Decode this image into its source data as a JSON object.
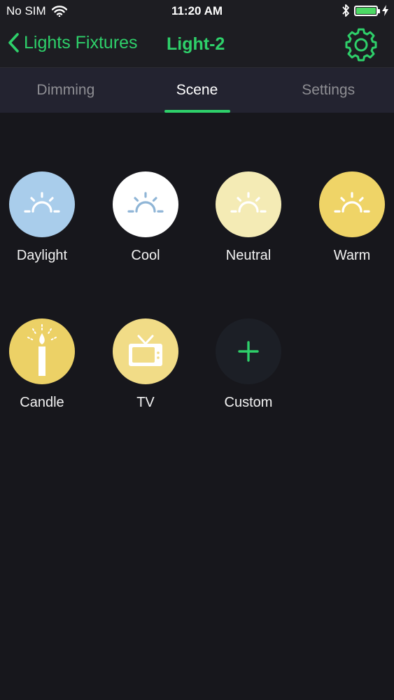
{
  "status": {
    "carrier": "No SIM",
    "time": "11:20 AM"
  },
  "nav": {
    "back_label": "Lights Fixtures",
    "title": "Light-2"
  },
  "tabs": [
    {
      "label": "Dimming"
    },
    {
      "label": "Scene"
    },
    {
      "label": "Settings"
    }
  ],
  "active_tab": "Scene",
  "scenes": [
    {
      "label": "Daylight",
      "color": "#a9cdeb",
      "icon": "sunrise-icon"
    },
    {
      "label": "Cool",
      "color": "#ffffff",
      "icon": "sunrise-icon"
    },
    {
      "label": "Neutral",
      "color": "#f4ebb5",
      "icon": "sunrise-icon"
    },
    {
      "label": "Warm",
      "color": "#efd467",
      "icon": "sunrise-icon"
    },
    {
      "label": "Candle",
      "color": "#ecd166",
      "icon": "candle-icon"
    },
    {
      "label": "TV",
      "color": "#f1dc87",
      "icon": "tv-icon"
    },
    {
      "label": "Custom",
      "color": "#1c1f26",
      "icon": "plus-icon"
    }
  ],
  "colors": {
    "accent": "#2ed06a",
    "background": "#17171c"
  }
}
